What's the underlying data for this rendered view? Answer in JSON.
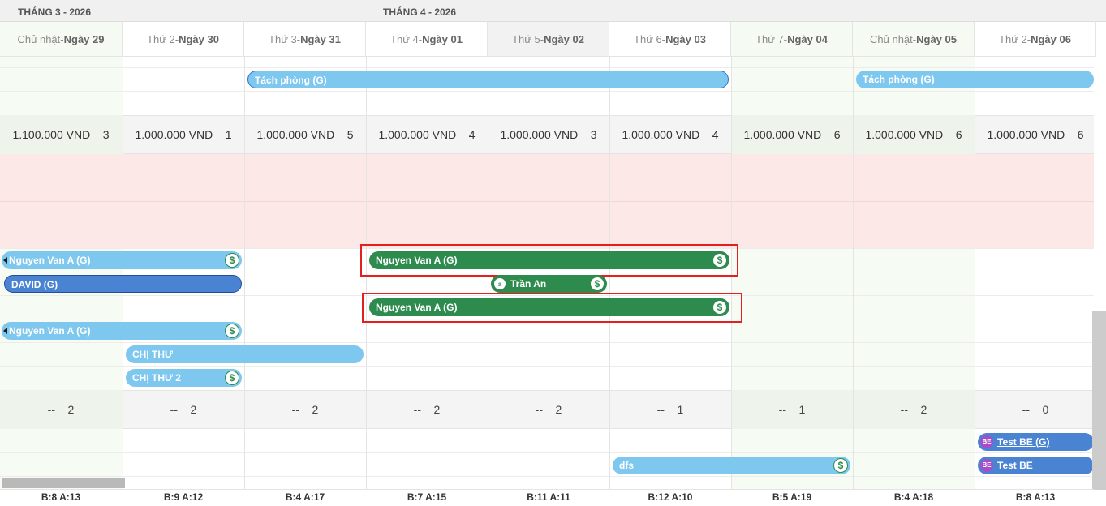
{
  "months": [
    "THÁNG 3 - 2026",
    "THÁNG 4 - 2026"
  ],
  "days": [
    {
      "weekday": "Chủ nhật",
      "date": "Ngày 29",
      "price": "1.100.000 VND",
      "price_count": "3",
      "count_dash": "--",
      "count": "2",
      "b": "B:8",
      "a": "A:13"
    },
    {
      "weekday": "Thứ 2",
      "date": "Ngày 30",
      "price": "1.000.000 VND",
      "price_count": "1",
      "count_dash": "--",
      "count": "2",
      "b": "B:9",
      "a": "A:12"
    },
    {
      "weekday": "Thứ 3",
      "date": "Ngày 31",
      "price": "1.000.000 VND",
      "price_count": "5",
      "count_dash": "--",
      "count": "2",
      "b": "B:4",
      "a": "A:17"
    },
    {
      "weekday": "Thứ 4",
      "date": "Ngày 01",
      "price": "1.000.000 VND",
      "price_count": "4",
      "count_dash": "--",
      "count": "2",
      "b": "B:7",
      "a": "A:15"
    },
    {
      "weekday": "Thứ 5",
      "date": "Ngày 02",
      "price": "1.000.000 VND",
      "price_count": "3",
      "count_dash": "--",
      "count": "2",
      "b": "B:11",
      "a": "A:11"
    },
    {
      "weekday": "Thứ 6",
      "date": "Ngày 03",
      "price": "1.000.000 VND",
      "price_count": "4",
      "count_dash": "--",
      "count": "1",
      "b": "B:12",
      "a": "A:10"
    },
    {
      "weekday": "Thứ 7",
      "date": "Ngày 04",
      "price": "1.000.000 VND",
      "price_count": "6",
      "count_dash": "--",
      "count": "1",
      "b": "B:5",
      "a": "A:19"
    },
    {
      "weekday": "Chủ nhật",
      "date": "Ngày 05",
      "price": "1.000.000 VND",
      "price_count": "6",
      "count_dash": "--",
      "count": "2",
      "b": "B:4",
      "a": "A:18"
    },
    {
      "weekday": "Thứ 2",
      "date": "Ngày 06",
      "price": "1.000.000 VND",
      "price_count": "6",
      "count_dash": "--",
      "count": "0",
      "b": "B:8",
      "a": "A:13"
    }
  ],
  "bookings": {
    "tach_phong_1": "Tách phòng (G)",
    "tach_phong_2": "Tách phòng (G)",
    "nguyen_1": "Nguyen Van A (G)",
    "david": "DAVID (G)",
    "nguyen_2": "Nguyen Van A (G)",
    "chi_thu": "CHỊ THƯ",
    "chi_thu_2": "CHỊ THƯ 2",
    "nguyen_green_1": "Nguyen Van A (G)",
    "tran_an": "Trần An",
    "nguyen_green_2": "Nguyen Van A (G)",
    "dfs": "dfs",
    "test_be_g": "Test BE (G)",
    "test_be": "Test BE",
    "avatar_a": "a",
    "avatar_be": "BE",
    "dollar": "$"
  },
  "colors": {
    "light_bar": "#7ec7ee",
    "green_bar": "#2e8b4e",
    "blue_bar": "#4a83d1",
    "highlight": "#e41f1f",
    "pink_zone": "#fde8e8"
  }
}
